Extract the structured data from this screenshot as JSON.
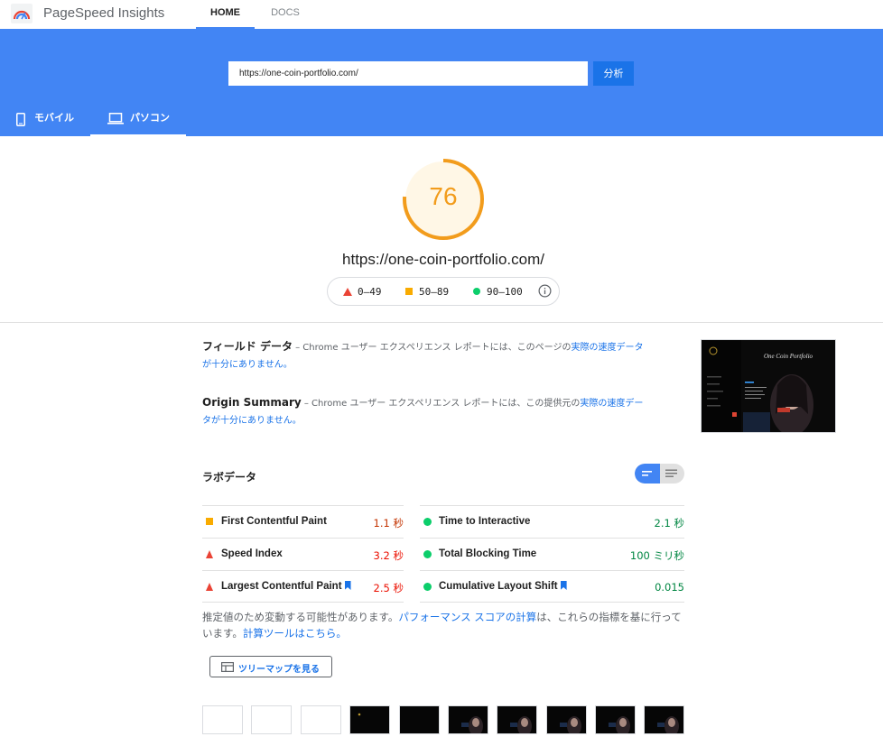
{
  "header": {
    "brand": "PageSpeed Insights",
    "nav": [
      {
        "label": "HOME",
        "active": true
      },
      {
        "label": "DOCS",
        "active": false
      }
    ],
    "logo_icon": "pagespeed-logo-icon"
  },
  "search": {
    "url_value": "https://one-coin-portfolio.com/",
    "analyze_label": "分析"
  },
  "device_tabs": {
    "mobile": {
      "label": "モバイル",
      "icon": "smartphone-icon",
      "active": false
    },
    "desktop": {
      "label": "パソコン",
      "icon": "laptop-icon",
      "active": true
    }
  },
  "score": {
    "value": "76",
    "fraction": 0.76,
    "color": "#f29c1c",
    "url": "https://one-coin-portfolio.com/"
  },
  "legend": {
    "poor": "0–49",
    "average": "50–89",
    "good": "90–100"
  },
  "field_data": {
    "title": "フィールド データ",
    "text_pre": " – Chrome ユーザー エクスペリエンス レポートには、このページの",
    "link": "実際の速度データが十分にありません。"
  },
  "origin_summary": {
    "title": "Origin Summary",
    "text_pre": " – Chrome ユーザー エクスペリエンス レポートには、この提供元の",
    "link": "実際の速度データが十分にありません。"
  },
  "screenshot": {
    "title": "One Coin Portfolio"
  },
  "lab_data": {
    "title": "ラボデータ",
    "metrics": [
      {
        "name": "First Contentful Paint",
        "value": "1.1 秒",
        "status": "average",
        "color": "#c33300",
        "bookmark": false
      },
      {
        "name": "Time to Interactive",
        "value": "2.1 秒",
        "status": "good",
        "color": "#018642",
        "bookmark": false
      },
      {
        "name": "Speed Index",
        "value": "3.2 秒",
        "status": "poor",
        "color": "#eb0f00",
        "bookmark": false
      },
      {
        "name": "Total Blocking Time",
        "value": "100 ミリ秒",
        "status": "good",
        "color": "#018642",
        "bookmark": false
      },
      {
        "name": "Largest Contentful Paint",
        "value": "2.5 秒",
        "status": "poor",
        "color": "#eb0f00",
        "bookmark": true
      },
      {
        "name": "Cumulative Layout Shift",
        "value": "0.015",
        "status": "good",
        "color": "#018642",
        "bookmark": true
      }
    ],
    "note_pre": "推定値のため変動する可能性があります。",
    "note_link1": "パフォーマンス スコアの計算",
    "note_mid": "は、これらの指標を基に行っています。",
    "note_link2": "計算ツールはこちら。",
    "treemap_label": "ツリーマップを見る"
  },
  "colors": {
    "brand_blue": "#4285f4",
    "button_blue": "#1a73e8",
    "poor": "#ea4335",
    "average": "#f9ab00",
    "good": "#0cce6b"
  }
}
